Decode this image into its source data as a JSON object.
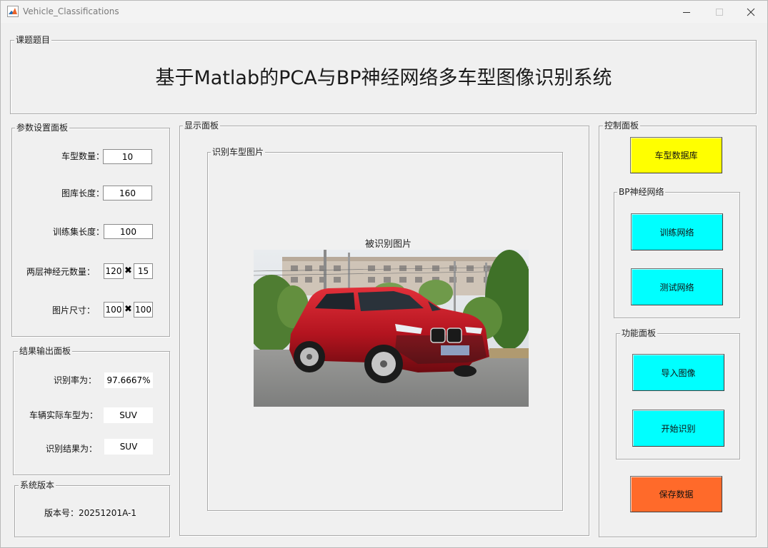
{
  "window": {
    "title": "Vehicle_Classifications"
  },
  "topic": {
    "panel_title": "课题题目",
    "main_title": "基于Matlab的PCA与BP神经网络多车型图像识别系统"
  },
  "params": {
    "panel_title": "参数设置面板",
    "num_types_label": "车型数量：",
    "num_types": "10",
    "lib_len_label": "图库长度：",
    "lib_len": "160",
    "train_len_label": "训练集长度：",
    "train_len": "100",
    "neurons_label": "两层神经元数量：",
    "neurons1": "120",
    "neurons2": "15",
    "img_size_label": "图片尺寸：",
    "img_w": "100",
    "img_h": "100",
    "times": "✖"
  },
  "results": {
    "panel_title": "结果输出面板",
    "rate_label": "识别率为：",
    "rate": "97.6667%",
    "actual_label": "车辆实际车型为：",
    "actual": "SUV",
    "result_label": "识别结果为：",
    "result": "SUV"
  },
  "version": {
    "panel_title": "系统版本",
    "text": "版本号：20251201A-1"
  },
  "display": {
    "panel_title": "显示面板",
    "sub_title": "识别车型图片",
    "img_caption": "被识别图片"
  },
  "control": {
    "panel_title": "控制面板",
    "db_button": "车型数据库",
    "bp_title": "BP神经网络",
    "train_button": "训练网络",
    "test_button": "测试网络",
    "func_title": "功能面板",
    "import_button": "导入图像",
    "start_button": "开始识别",
    "save_button": "保存数据"
  },
  "colors": {
    "yellow": "#ffff00",
    "cyan": "#00ffff",
    "orange": "#ff6a2a"
  }
}
